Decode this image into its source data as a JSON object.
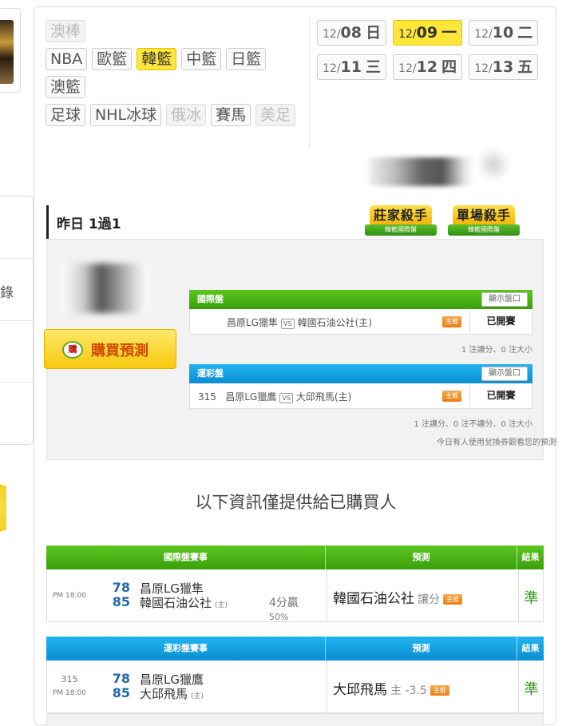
{
  "sports": {
    "rows": [
      [
        {
          "label": "澳棒",
          "state": "dim"
        }
      ],
      [
        {
          "label": "NBA",
          "state": "normal"
        },
        {
          "label": "歐籃",
          "state": "normal"
        },
        {
          "label": "韓籃",
          "state": "active"
        },
        {
          "label": "中籃",
          "state": "normal"
        },
        {
          "label": "日籃",
          "state": "normal"
        }
      ],
      [
        {
          "label": "澳籃",
          "state": "normal"
        }
      ],
      [
        {
          "label": "足球",
          "state": "normal"
        },
        {
          "label": "NHL冰球",
          "state": "normal"
        },
        {
          "label": "俄冰",
          "state": "dim"
        },
        {
          "label": "賽馬",
          "state": "normal"
        },
        {
          "label": "美足",
          "state": "dim"
        }
      ]
    ]
  },
  "dates": {
    "rows": [
      [
        {
          "md": "12/",
          "dd": "08",
          "wd": "日",
          "active": false
        },
        {
          "md": "12/",
          "dd": "09",
          "wd": "一",
          "active": true
        },
        {
          "md": "12/",
          "dd": "10",
          "wd": "二",
          "active": false
        }
      ],
      [
        {
          "md": "12/",
          "dd": "11",
          "wd": "三",
          "active": false
        },
        {
          "md": "12/",
          "dd": "12",
          "wd": "四",
          "active": false
        },
        {
          "md": "12/",
          "dd": "13",
          "wd": "五",
          "active": false
        }
      ]
    ]
  },
  "sidebar": {
    "partial_char": "錄"
  },
  "yesterday": {
    "title": "昨日 1過1",
    "badge1": {
      "top": "莊家殺手",
      "bottom": "韓籃國際盤"
    },
    "badge2": {
      "top": "單場殺手",
      "bottom": "韓籃國際盤"
    }
  },
  "buy": {
    "icon_text": "購",
    "label": "購買預測"
  },
  "intl_panel": {
    "header": "國際盤",
    "button": "顯示盤口",
    "match": {
      "team_a": "昌原LG獵隼",
      "vs": "VS",
      "team_b": "韓國石油公社(主)",
      "tag": "主推",
      "status": "已開賽"
    },
    "note": "1 注讓分、0 注大小"
  },
  "lottery_panel": {
    "header": "運彩盤",
    "button": "顯示盤口",
    "match": {
      "id": "315",
      "team_a": "昌原LG獵鷹",
      "vs": "VS",
      "team_b": "大邱飛馬(主)",
      "tag": "主推",
      "status": "已開賽"
    },
    "note": "1 注讓分、0 注不讓分、0 注大小",
    "note2": "今日有人使用兌換券觀看您的預測"
  },
  "info_line": "以下資訊僅提供給已購買人",
  "intl_result": {
    "col_event": "國際盤賽事",
    "col_pred": "預測",
    "col_result": "結果",
    "time": "PM 18:00",
    "score_a": "78",
    "score_b": "85",
    "team_a": "昌原LG獵隼",
    "team_b": "韓國石油公社",
    "home_mark": "(主)",
    "extra_line1": "4分贏",
    "extra_line2": "50%",
    "prediction": "韓國石油公社",
    "pred_sub": "讓分",
    "pred_tag": "主推",
    "result": "準"
  },
  "lottery_result": {
    "col_event": "運彩盤賽事",
    "col_pred": "預測",
    "col_result": "結果",
    "id": "315",
    "time": "PM 18:00",
    "score_a": "78",
    "score_b": "85",
    "team_a": "昌原LG獵鷹",
    "team_b": "大邱飛馬",
    "home_mark": "(主)",
    "prediction": "大邱飛馬",
    "pred_sub": "主 -3.5",
    "pred_tag": "主推",
    "result": "準"
  },
  "colors": {
    "accent_yellow": "#ffe63a",
    "green_header": "#3a9f0b",
    "blue_header": "#0a8ed3",
    "score_blue": "#2269a8",
    "result_green": "#2a9a14",
    "tag_orange": "#ea7d12"
  }
}
